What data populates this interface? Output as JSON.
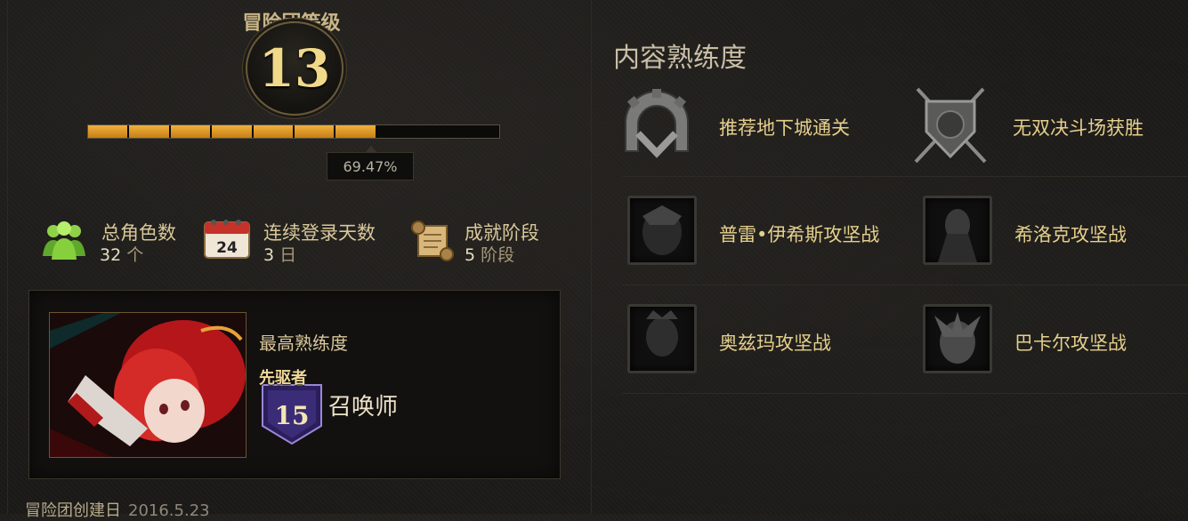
{
  "adventure": {
    "level_title": "冒险团等级",
    "level": "13",
    "progress_pct": 69.47,
    "progress_label": "69.47%",
    "progress_segments_total": 10,
    "progress_segments_filled": 7
  },
  "stats": [
    {
      "label": "总角色数",
      "value": "32",
      "unit": "个",
      "icon": "people-icon"
    },
    {
      "label": "连续登录天数",
      "value": "3",
      "unit": "日",
      "icon": "calendar-icon",
      "icon_text": "24"
    },
    {
      "label": "成就阶段",
      "value": "5",
      "unit": "阶段",
      "icon": "scroll-icon"
    }
  ],
  "top_proficiency": {
    "title": "最高熟练度",
    "rank_name": "先驱者",
    "rank_level": "15",
    "class_name": "召唤师"
  },
  "footer": {
    "label": "冒险团创建日",
    "date": "2016.5.23"
  },
  "content": {
    "title": "内容熟练度",
    "items": [
      {
        "name": "推荐地下城通关",
        "icon": "gear-gate-icon"
      },
      {
        "name": "无双决斗场获胜",
        "icon": "crossed-swords-shield-icon"
      },
      {
        "name": "普雷•伊希斯攻坚战",
        "icon": "prey-isis-portrait"
      },
      {
        "name": "希洛克攻坚战",
        "icon": "siroco-portrait"
      },
      {
        "name": "奥兹玛攻坚战",
        "icon": "ozma-portrait"
      },
      {
        "name": "巴卡尔攻坚战",
        "icon": "bakal-portrait"
      }
    ]
  },
  "colors": {
    "progress_fill": "#e39a2a",
    "gold_text": "#e6cf8c",
    "background": "#1b1a18"
  }
}
